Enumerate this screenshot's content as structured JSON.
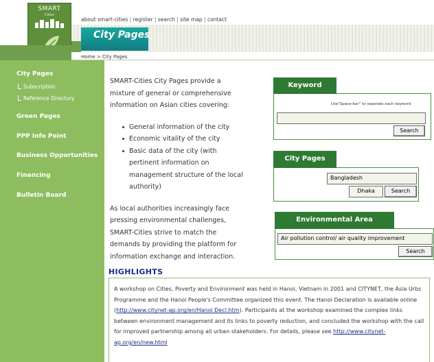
{
  "logo": {
    "text": "SMART",
    "subtext": "Cities"
  },
  "topnav": {
    "items": [
      "about smart-cities",
      "register",
      "search",
      "site map",
      "contact"
    ],
    "separator": " ¦ "
  },
  "banner": {
    "title": "City Pages"
  },
  "breadcrumb": {
    "home": "Home",
    "separator": " > ",
    "current": "City Pages"
  },
  "sidebar": {
    "items": [
      {
        "label": "City Pages"
      },
      {
        "label": "Subscription"
      },
      {
        "label": "Reference Directory"
      },
      {
        "label": "Green Pages"
      },
      {
        "label": "PPP Info Point"
      },
      {
        "label": "Business Opportunities"
      },
      {
        "label": "Financing"
      },
      {
        "label": "Bulletin Board"
      }
    ]
  },
  "intro": {
    "paragraph1": "SMART-Cities City Pages provide a mixture of general or comprehensive information on Asian cities covering:",
    "bullets": [
      "General information of the city",
      "Economic vitality of the city",
      "Basic data of the city (with pertinent information on management structure of the local authority)"
    ],
    "paragraph2": "As local authorities increasingly face pressing environmental challenges, SMART-Cities strive to match the demands by providing the platform for information exchange and interaction."
  },
  "keyword_panel": {
    "title": "Keyword",
    "hint": "Use\"Space-bar\" to seperate each keyword",
    "input_value": "",
    "search_label": "Search"
  },
  "city_panel": {
    "title": "City Pages",
    "country": "Bangladesh",
    "city": "Dhaka",
    "search_label": "Search"
  },
  "env_panel": {
    "title": "Environmental Area",
    "selected": "Air pollution control/ air quality improvement",
    "search_label": "Search"
  },
  "highlights": {
    "title": "HIGHLIGHTS",
    "text_before": "A workshop on Cities, Poverty and Environment was held in Hanoi, Vietnam in 2001 and CITYNET, the Asia Urbs Programme and the Hanoi People's Committee organized this event. The Hanoi Declaration is available online (",
    "link1": "http://www.citynet-ap.org/en/Hanoi Decl.htm",
    "text_middle": "). Participants at the workshop examined the complex links between environment management and its links to poverty reduction, and concluded the workshop with the call for improved partnership among all urban stakeholders. For details, please see ",
    "link2": "http://www.citynet-ap.org/en/new.html"
  },
  "colors": {
    "sidebar": "#8dbd5e",
    "panel_tab": "#2f7a32",
    "banner": "#1aa8a0",
    "highlight_title": "#1a2e8a"
  }
}
